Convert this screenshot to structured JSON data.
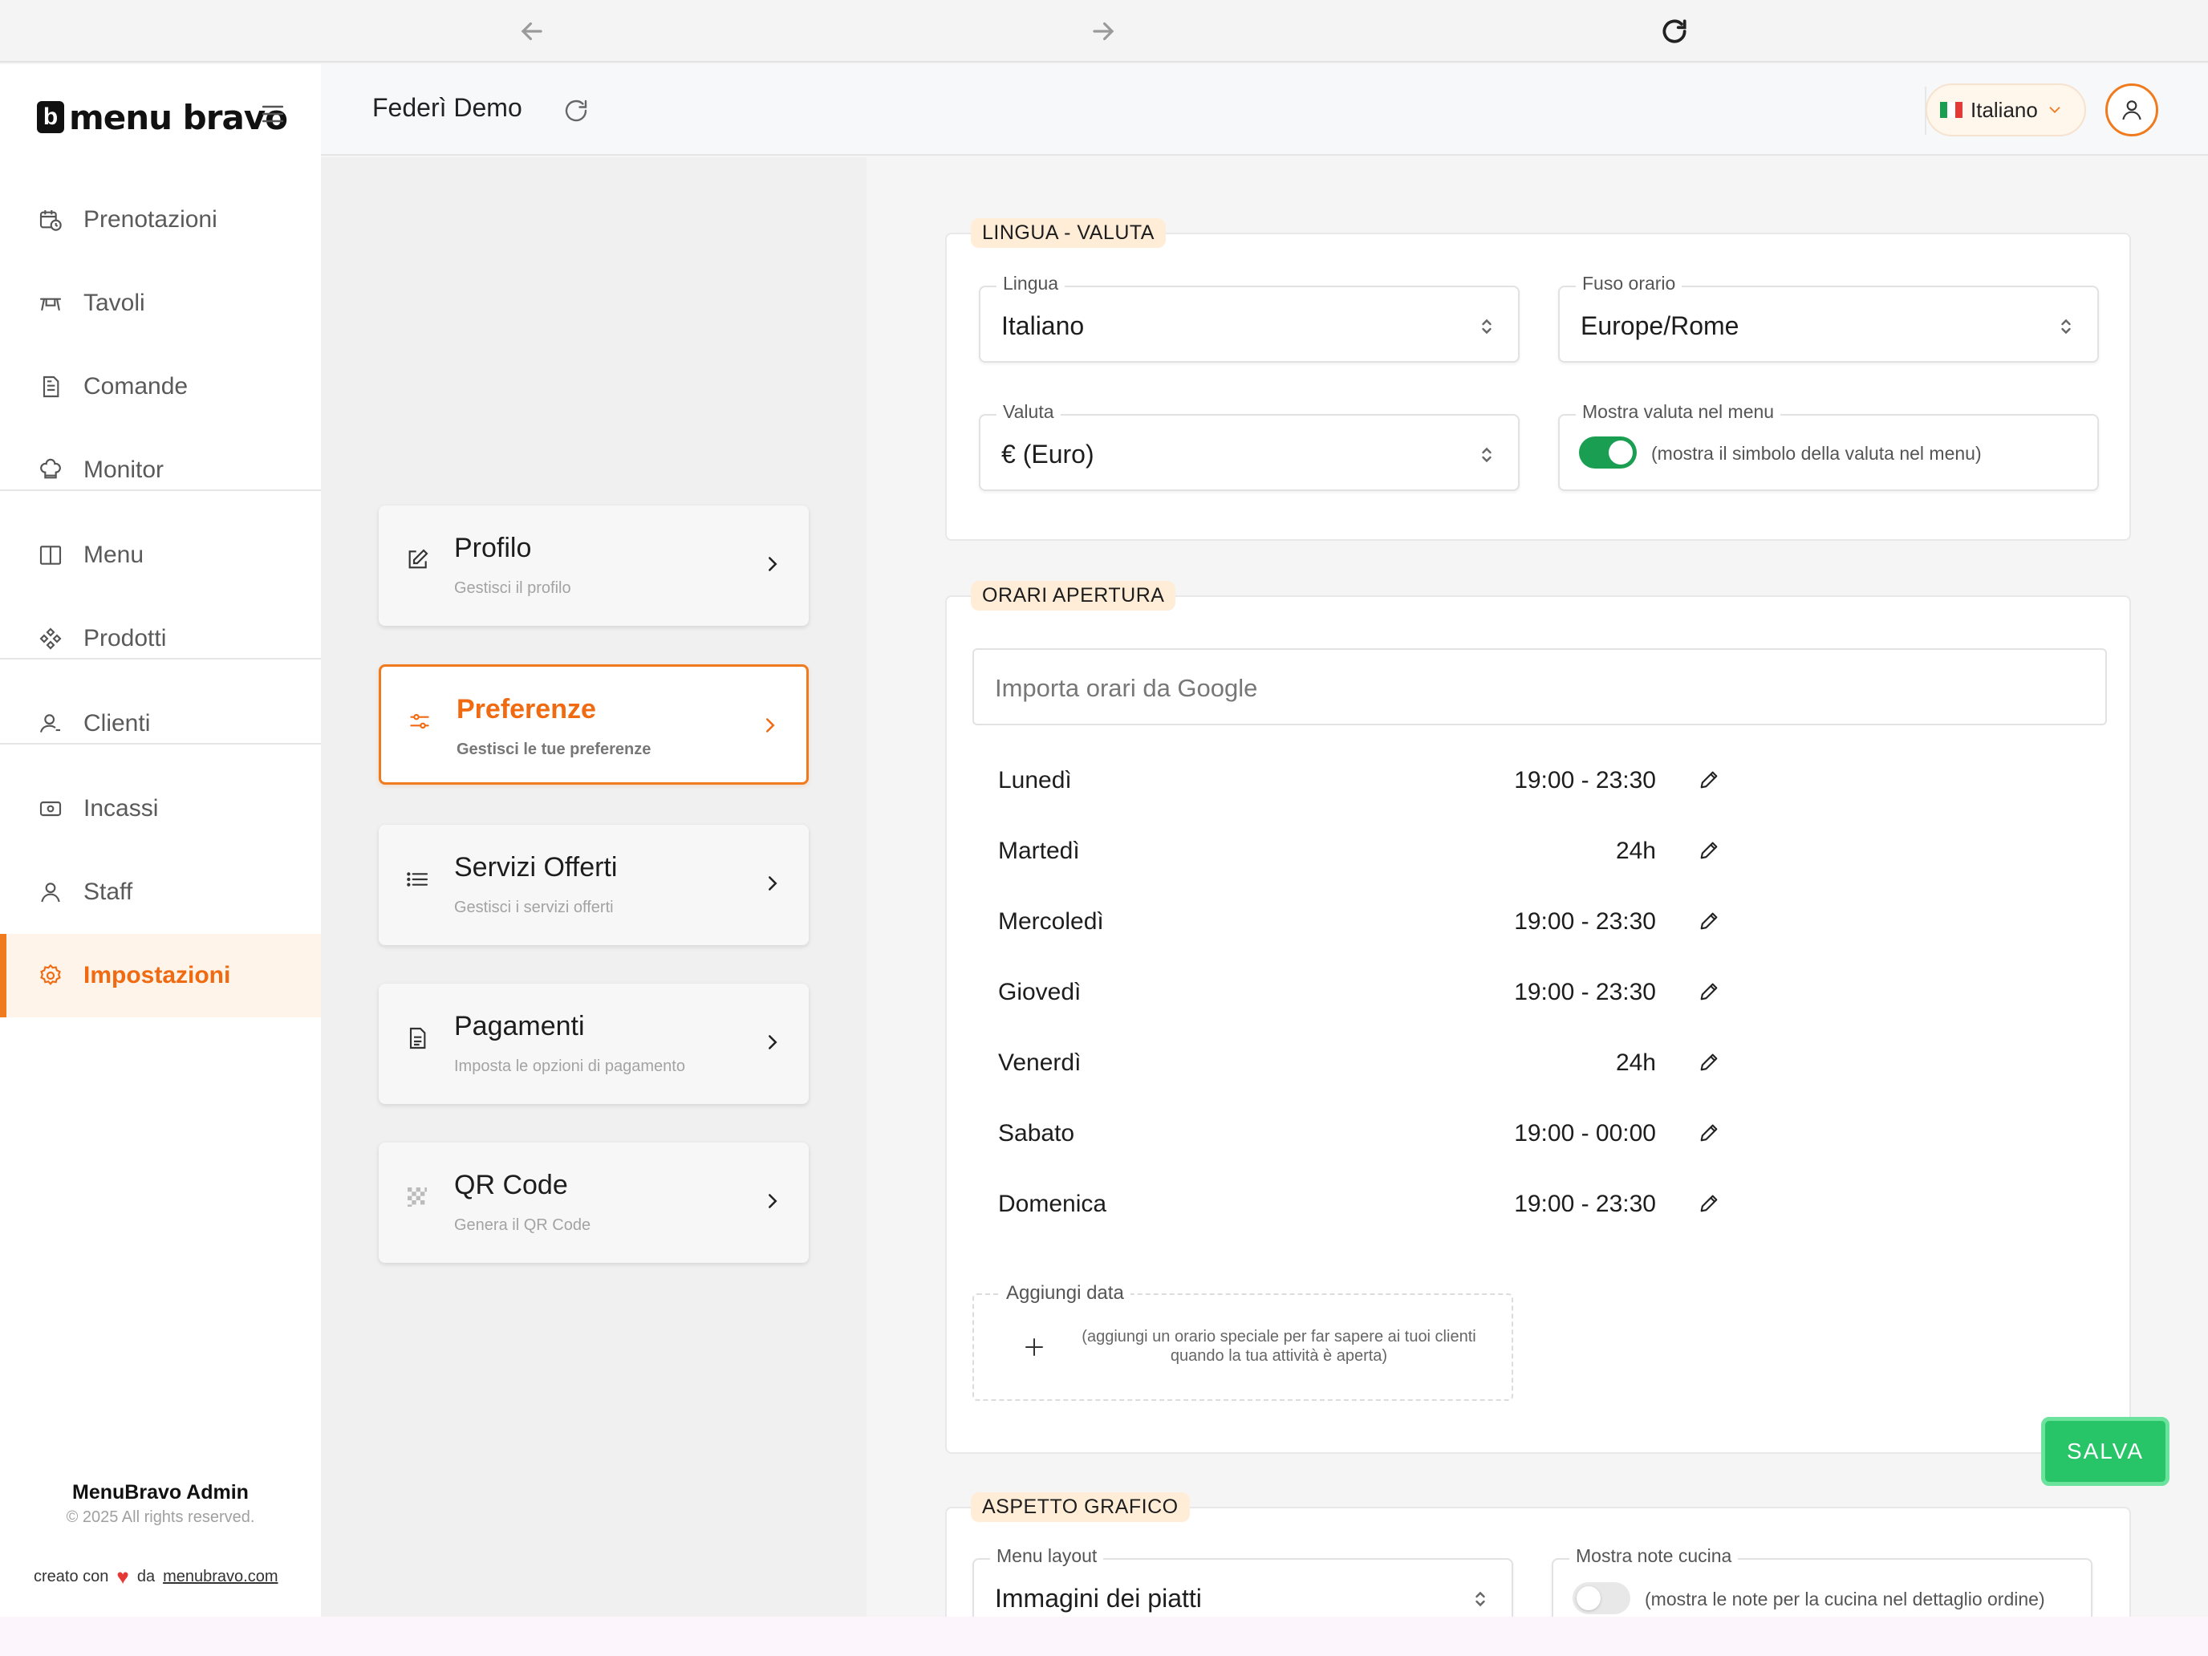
{
  "brand": {
    "logo_mark": "b",
    "name": "menu bravo"
  },
  "sidebar": {
    "items": [
      {
        "label": "Prenotazioni",
        "icon": "calendar-clock-icon"
      },
      {
        "label": "Tavoli",
        "icon": "table-icon"
      },
      {
        "label": "Comande",
        "icon": "document-icon"
      },
      {
        "label": "Monitor",
        "icon": "chef-hat-icon"
      },
      {
        "label": "Menu",
        "icon": "book-open-icon"
      },
      {
        "label": "Prodotti",
        "icon": "diamond-grid-icon"
      },
      {
        "label": "Clienti",
        "icon": "user-icon"
      },
      {
        "label": "Incassi",
        "icon": "cash-icon"
      },
      {
        "label": "Staff",
        "icon": "person-icon"
      },
      {
        "label": "Impostazioni",
        "icon": "gear-icon",
        "active": true
      }
    ],
    "footer": {
      "title": "MenuBravo Admin",
      "copyright": "© 2025 All rights reserved.",
      "credit_prefix": "creato con",
      "heart": "♥",
      "credit_mid": "da",
      "credit_link": "menubravo.com"
    }
  },
  "header": {
    "store_name": "Federì Demo",
    "language": "Italiano"
  },
  "settings_nav": [
    {
      "title": "Profilo",
      "subtitle": "Gestisci il profilo",
      "icon": "edit-icon"
    },
    {
      "title": "Preferenze",
      "subtitle": "Gestisci le tue preferenze",
      "icon": "sliders-icon",
      "active": true
    },
    {
      "title": "Servizi Offerti",
      "subtitle": "Gestisci i servizi offerti",
      "icon": "list-icon"
    },
    {
      "title": "Pagamenti",
      "subtitle": "Imposta le opzioni di pagamento",
      "icon": "receipt-icon"
    },
    {
      "title": "QR Code",
      "subtitle": "Genera il QR Code",
      "icon": "qr-icon"
    }
  ],
  "lingua_valuta": {
    "section_title": "LINGUA - VALUTA",
    "lingua": {
      "label": "Lingua",
      "value": "Italiano"
    },
    "fuso": {
      "label": "Fuso orario",
      "value": "Europe/Rome"
    },
    "valuta": {
      "label": "Valuta",
      "value": "€ (Euro)"
    },
    "mostra_valuta": {
      "label": "Mostra valuta nel menu",
      "text": "(mostra il simbolo della valuta nel menu)",
      "enabled": true
    }
  },
  "orari": {
    "section_title": "ORARI APERTURA",
    "import_placeholder": "Importa orari da Google",
    "days": [
      {
        "day": "Lunedì",
        "time": "19:00 - 23:30"
      },
      {
        "day": "Martedì",
        "time": "24h"
      },
      {
        "day": "Mercoledì",
        "time": "19:00 - 23:30"
      },
      {
        "day": "Giovedì",
        "time": "19:00 - 23:30"
      },
      {
        "day": "Venerdì",
        "time": "24h"
      },
      {
        "day": "Sabato",
        "time": "19:00 - 00:00"
      },
      {
        "day": "Domenica",
        "time": "19:00 - 23:30"
      }
    ],
    "add_date": {
      "label": "Aggiungi data",
      "description": "(aggiungi un orario speciale per far sapere ai tuoi clienti quando la tua attività è aperta)"
    }
  },
  "aspetto": {
    "section_title": "ASPETTO GRAFICO",
    "layout": {
      "label": "Menu layout",
      "value": "Immagini dei piatti"
    },
    "note_cucina": {
      "label": "Mostra note cucina",
      "text": "(mostra le note per la cucina nel dettaglio ordine)",
      "enabled": false
    }
  },
  "save_label": "SALVA",
  "colors": {
    "accent": "#f07a1e",
    "success": "#27c468",
    "toggle_on": "#1a9e52"
  }
}
